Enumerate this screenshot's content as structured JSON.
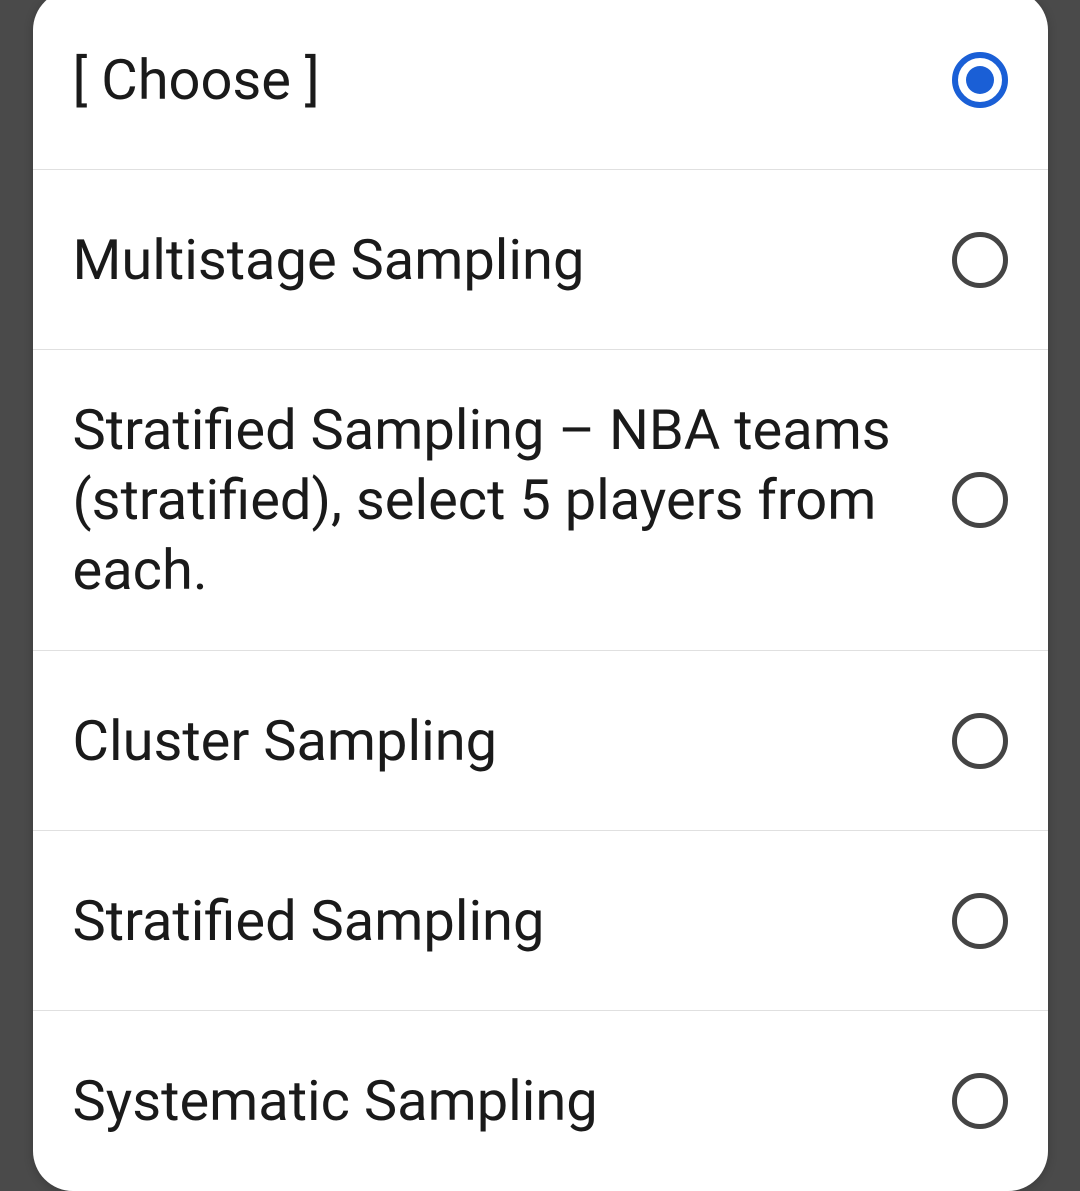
{
  "dropdown": {
    "options": [
      {
        "label": "[ Choose ]",
        "selected": true
      },
      {
        "label": "Multistage Sampling",
        "selected": false
      },
      {
        "label": "Stratified Sampling – NBA teams (stratified), select 5 players from each.",
        "selected": false
      },
      {
        "label": "Cluster Sampling",
        "selected": false
      },
      {
        "label": "Stratified Sampling",
        "selected": false
      },
      {
        "label": "Systematic Sampling",
        "selected": false
      }
    ]
  }
}
